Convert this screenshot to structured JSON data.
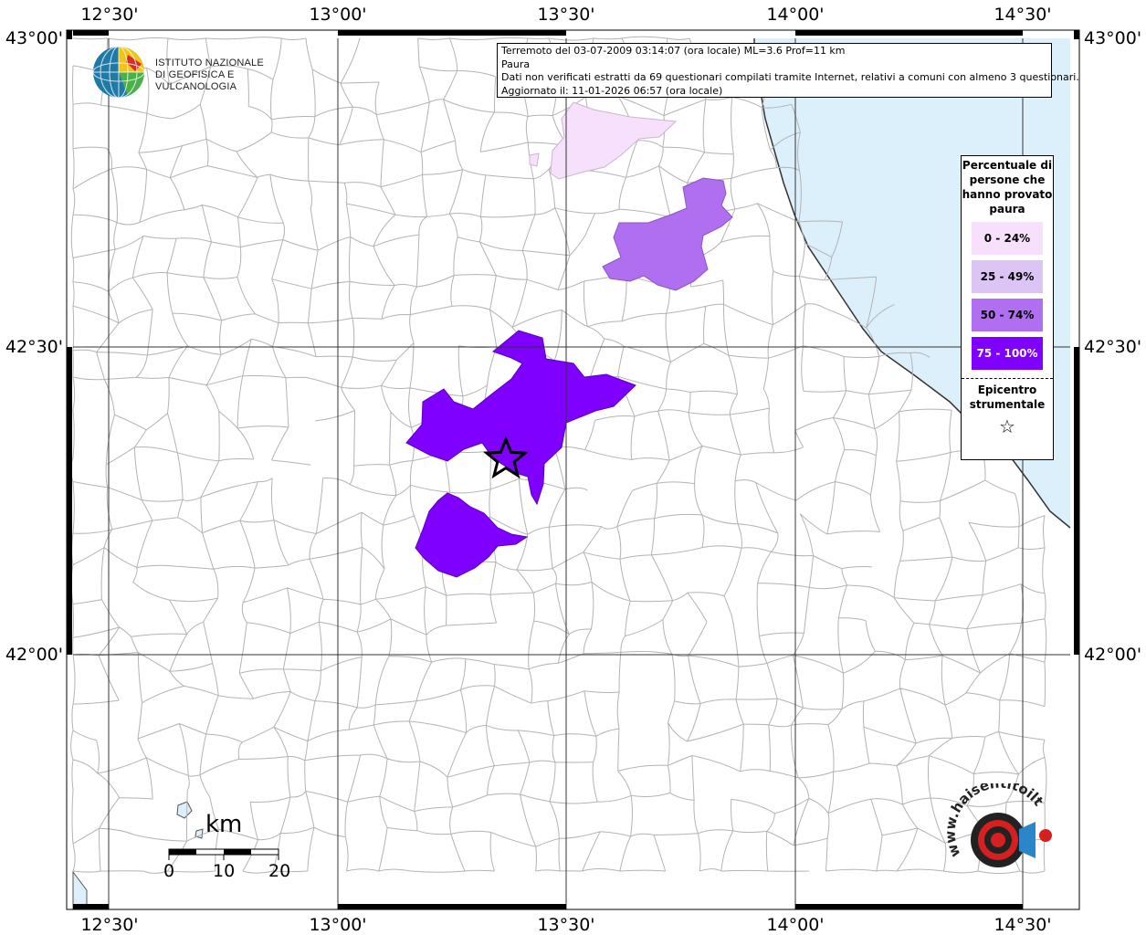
{
  "info": {
    "line1": "Terremoto del 03-07-2009 03:14:07 (ora locale) ML=3.6 Prof=11 km",
    "line2": "Paura",
    "line3": "Dati non verificati estratti da 69 questionari compilati tramite Internet, relativi a comuni con almeno 3 questionari.",
    "line4": "Aggiornato il: 11-01-2026 06:57 (ora locale)"
  },
  "axes": {
    "x_labels": [
      "12°30'",
      "13°00'",
      "13°30'",
      "14°00'",
      "14°30'"
    ],
    "y_labels": [
      "43°00'",
      "42°30'",
      "42°00'"
    ]
  },
  "legend": {
    "title": "Percentuale di persone che hanno provato paura",
    "classes": [
      {
        "label": "0 - 24%",
        "color": "#f7e0fb"
      },
      {
        "label": "25 - 49%",
        "color": "#dcc4f5"
      },
      {
        "label": "50 - 74%",
        "color": "#b06ef0"
      },
      {
        "label": "75 - 100%",
        "color": "#7f00ff"
      }
    ],
    "epicenter_label": "Epicentro strumentale",
    "epicenter_symbol": "☆"
  },
  "institute": {
    "line1": "ISTITUTO NAZIONALE",
    "line2": "DI GEOFISICA E VULCANOLOGIA"
  },
  "scale": {
    "unit": "km",
    "ticks": [
      "0",
      "10",
      "20"
    ]
  },
  "website": {
    "text": "www.haisentitoilterremoto.it"
  },
  "colors": {
    "sea": "#dcf0fc",
    "border": "#999999"
  }
}
